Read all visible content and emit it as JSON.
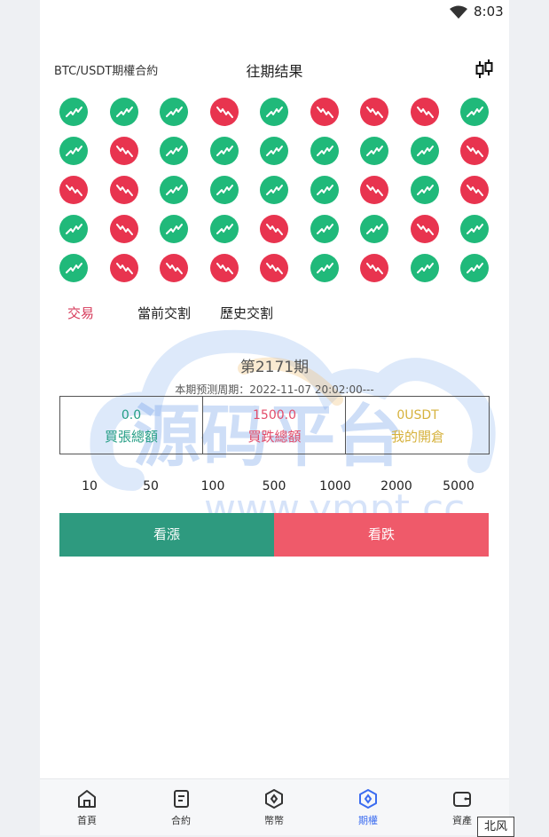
{
  "status_bar": {
    "time": "8:03",
    "wifi_icon": "wifi-icon"
  },
  "header": {
    "pair": "BTC/USDT期權合約",
    "title": "往期结果",
    "chart_icon": "candlestick-icon"
  },
  "results": [
    [
      "up",
      "up",
      "up",
      "down",
      "up",
      "down",
      "down",
      "down",
      "up"
    ],
    [
      "up",
      "down",
      "up",
      "up",
      "up",
      "up",
      "up",
      "up",
      "down"
    ],
    [
      "down",
      "down",
      "up",
      "up",
      "up",
      "up",
      "down",
      "up",
      "down"
    ],
    [
      "up",
      "down",
      "up",
      "up",
      "down",
      "up",
      "up",
      "down",
      "up"
    ],
    [
      "up",
      "down",
      "down",
      "down",
      "down",
      "up",
      "down",
      "up",
      "up"
    ]
  ],
  "colors": {
    "up": "#20b97a",
    "down": "#e8344f",
    "accent_tab": "#d63a5a",
    "rise_button": "#2e9a7f",
    "fall_button": "#ef5a6a",
    "nav_active": "#3b6cf0"
  },
  "tabs": [
    {
      "label": "交易",
      "active": true
    },
    {
      "label": "當前交割",
      "active": false
    },
    {
      "label": "歷史交割",
      "active": false
    }
  ],
  "period": {
    "label": "第2171期",
    "predict": "本期预测周期：2022-11-07 20:02:00---"
  },
  "stats": {
    "buy": {
      "value": "0.0",
      "label": "買張總額"
    },
    "sell": {
      "value": "1500.0",
      "label": "買跌總額"
    },
    "mine": {
      "value": "0USDT",
      "label": "我的開倉"
    }
  },
  "amounts": [
    "10",
    "50",
    "100",
    "500",
    "1000",
    "2000",
    "5000"
  ],
  "buttons": {
    "rise": "看漲",
    "fall": "看跌"
  },
  "watermark": {
    "text": "源码平台",
    "url": "www.ympt.cc"
  },
  "nav": [
    {
      "label": "首頁",
      "icon": "home-icon",
      "active": false
    },
    {
      "label": "合約",
      "icon": "contract-icon",
      "active": false
    },
    {
      "label": "幣幣",
      "icon": "coin-icon",
      "active": false
    },
    {
      "label": "期權",
      "icon": "options-icon",
      "active": true
    },
    {
      "label": "資產",
      "icon": "wallet-icon",
      "active": false
    }
  ],
  "corner_label": "北风"
}
